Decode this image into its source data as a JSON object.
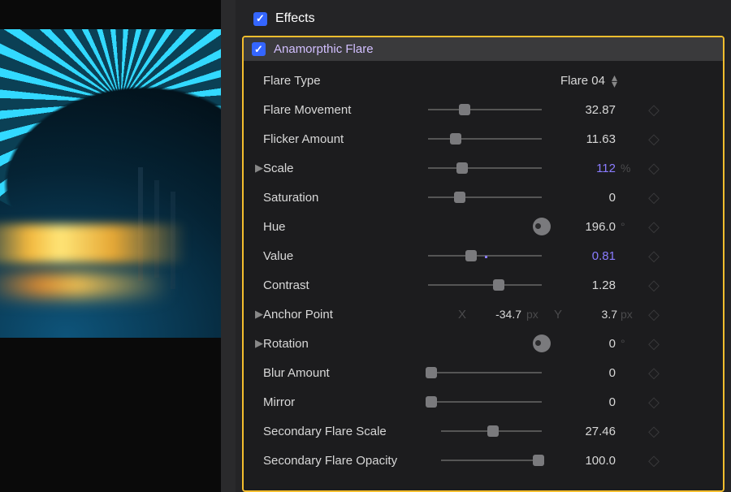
{
  "header": {
    "title": "Effects"
  },
  "effect": {
    "name": "Anamorpthic Flare",
    "params": {
      "flare_type": {
        "label": "Flare Type",
        "value": "Flare 04"
      },
      "flare_movement": {
        "label": "Flare Movement",
        "value": "32.87",
        "pos": 32
      },
      "flicker_amount": {
        "label": "Flicker Amount",
        "value": "11.63",
        "pos": 24
      },
      "scale": {
        "label": "Scale",
        "value": "112",
        "unit": "%",
        "pos": 30
      },
      "saturation": {
        "label": "Saturation",
        "value": "0",
        "pos": 28
      },
      "hue": {
        "label": "Hue",
        "value": "196.0",
        "unit": "°"
      },
      "value_p": {
        "label": "Value",
        "value": "0.81",
        "pos": 38,
        "tick": 50
      },
      "contrast": {
        "label": "Contrast",
        "value": "1.28",
        "pos": 62
      },
      "anchor_point": {
        "label": "Anchor Point",
        "x_label": "X",
        "x": "-34.7",
        "x_unit": "px",
        "y_label": "Y",
        "y": "3.7",
        "y_unit": "px"
      },
      "rotation": {
        "label": "Rotation",
        "value": "0",
        "unit": "°"
      },
      "blur_amount": {
        "label": "Blur Amount",
        "value": "0",
        "pos": 3
      },
      "mirror": {
        "label": "Mirror",
        "value": "0",
        "pos": 3
      },
      "sec_scale": {
        "label": "Secondary Flare Scale",
        "value": "27.46",
        "pos": 52
      },
      "sec_opacity": {
        "label": "Secondary Flare Opacity",
        "value": "100.0",
        "pos": 97
      }
    }
  }
}
